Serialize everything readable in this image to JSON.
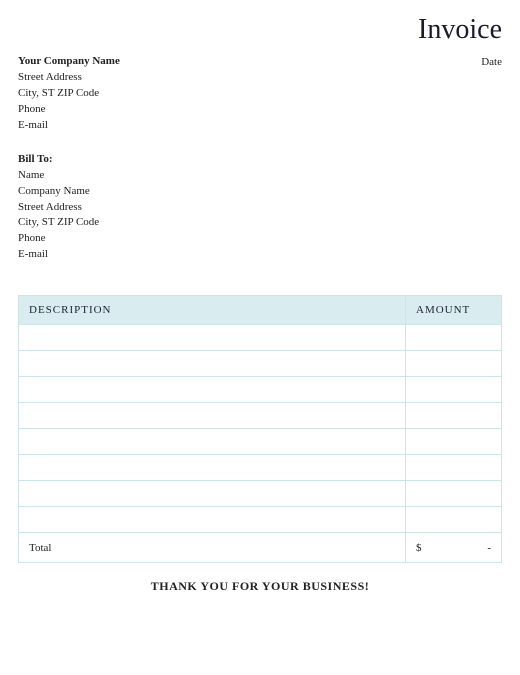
{
  "header": {
    "title": "Invoice",
    "date_label": "Date"
  },
  "from": {
    "company": "Your Company Name",
    "street": "Street Address",
    "citystzip": "City, ST  ZIP Code",
    "phone": "Phone",
    "email": "E-mail"
  },
  "billto": {
    "heading": "Bill To:",
    "name": "Name",
    "company": "Company Name",
    "street": "Street Address",
    "citystzip": "City, ST  ZIP Code",
    "phone": "Phone",
    "email": "E-mail"
  },
  "table": {
    "col_desc": "DESCRIPTION",
    "col_amount": "AMOUNT",
    "rows": [
      {
        "desc": "",
        "amount": ""
      },
      {
        "desc": "",
        "amount": ""
      },
      {
        "desc": "",
        "amount": ""
      },
      {
        "desc": "",
        "amount": ""
      },
      {
        "desc": "",
        "amount": ""
      },
      {
        "desc": "",
        "amount": ""
      },
      {
        "desc": "",
        "amount": ""
      },
      {
        "desc": "",
        "amount": ""
      }
    ],
    "total_label": "Total",
    "total_currency": "$",
    "total_value": "-"
  },
  "footer": {
    "thanks": "THANK YOU FOR YOUR BUSINESS!"
  }
}
